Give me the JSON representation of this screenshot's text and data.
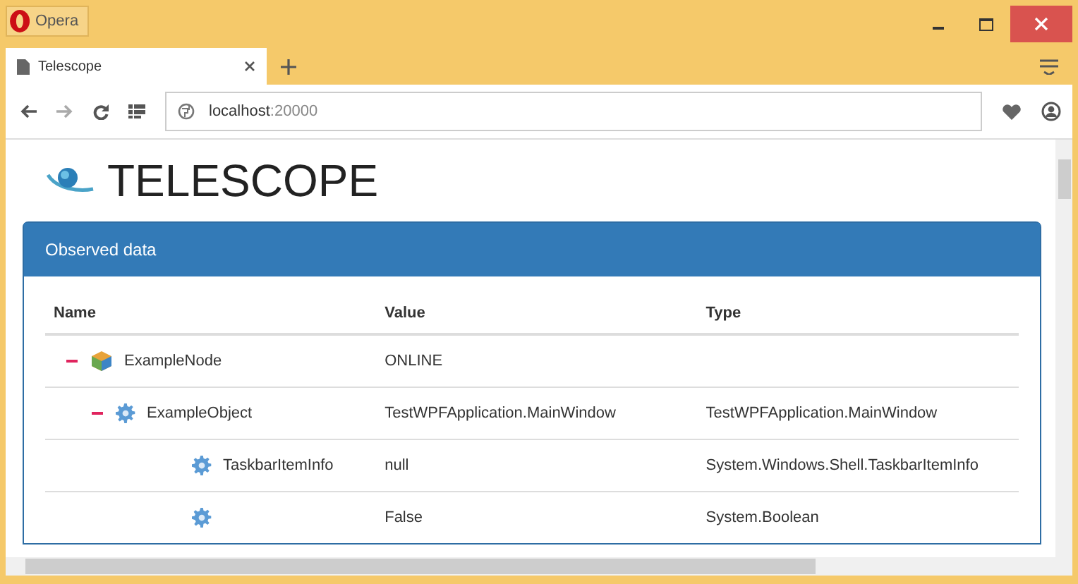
{
  "window": {
    "title": "Opera"
  },
  "tabs": [
    {
      "label": "Telescope",
      "selected": true
    }
  ],
  "address_bar": {
    "host": "localhost",
    "port": ":20000"
  },
  "page": {
    "heading": "TELESCOPE",
    "panel_title": "Observed data",
    "table": {
      "columns": [
        "Name",
        "Value",
        "Type"
      ],
      "rows": [
        {
          "kind": "node",
          "name": "ExampleNode",
          "value": "ONLINE",
          "expanded": true,
          "children": [
            {
              "kind": "object",
              "name": "ExampleObject",
              "value": "TestWPFApplication.MainWindow",
              "type": "TestWPFApplication.MainWindow",
              "expanded": true,
              "children": [
                {
                  "kind": "object",
                  "name": "TaskbarItemInfo",
                  "value": "null",
                  "type": "System.Windows.Shell.TaskbarItemInfo"
                },
                {
                  "kind": "object",
                  "value": "False",
                  "type": "System.Boolean"
                }
              ]
            }
          ]
        }
      ]
    }
  }
}
